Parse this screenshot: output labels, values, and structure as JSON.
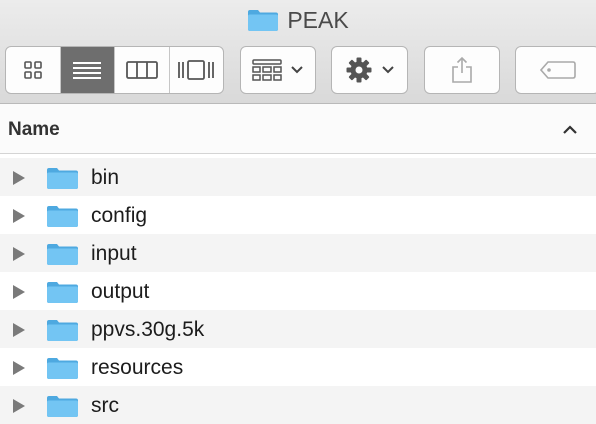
{
  "window": {
    "title": "PEAK"
  },
  "toolbar": {
    "view_modes": [
      "icon-view",
      "list-view",
      "column-view",
      "cover-flow-view"
    ],
    "active_view": "list-view",
    "buttons": [
      "arrange-menu",
      "action-menu",
      "share",
      "tags"
    ]
  },
  "columns": {
    "name_header": "Name",
    "sort": "ascending"
  },
  "files": [
    {
      "name": "bin",
      "kind": "folder"
    },
    {
      "name": "config",
      "kind": "folder"
    },
    {
      "name": "input",
      "kind": "folder"
    },
    {
      "name": "output",
      "kind": "folder"
    },
    {
      "name": "ppvs.30g.5k",
      "kind": "folder"
    },
    {
      "name": "resources",
      "kind": "folder"
    },
    {
      "name": "src",
      "kind": "folder"
    }
  ],
  "colors": {
    "folder_blue": "#6fc3f2",
    "folder_tab": "#4ea9e0",
    "alt_row": "#f4f4f4",
    "active_segment": "#6e6e6e"
  }
}
